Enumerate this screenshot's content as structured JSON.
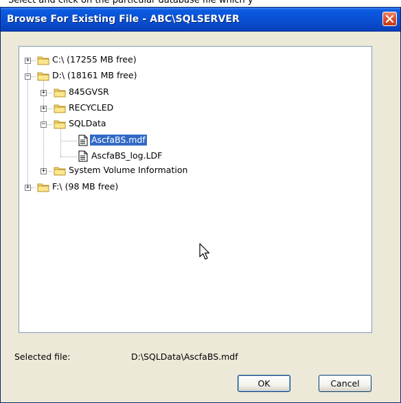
{
  "caption": "Select and click on the particular database file which y",
  "dialog": {
    "title": "Browse For Existing File - ABC\\SQLSERVER",
    "close_icon": "close-x"
  },
  "tree": {
    "nodes": [
      {
        "label": "C:\\ (17255 MB free)",
        "icon": "folder",
        "expander": "+"
      },
      {
        "label": "D:\\ (18161 MB free)",
        "icon": "folder",
        "expander": "-"
      },
      {
        "label": "845GVSR",
        "icon": "folder",
        "expander": "+"
      },
      {
        "label": "RECYCLED",
        "icon": "folder",
        "expander": "+"
      },
      {
        "label": "SQLData",
        "icon": "folder",
        "expander": "-"
      },
      {
        "label": "AscfaBS.mdf",
        "icon": "file",
        "selected": true
      },
      {
        "label": "AscfaBS_log.LDF",
        "icon": "file"
      },
      {
        "label": "System Volume Information",
        "icon": "folder",
        "expander": "+"
      },
      {
        "label": "F:\\ (98 MB free)",
        "icon": "folder",
        "expander": "+"
      }
    ]
  },
  "selected_file": {
    "label": "Selected file:",
    "value": "D:\\SQLData\\AscfaBS.mdf"
  },
  "buttons": {
    "ok": "OK",
    "cancel": "Cancel"
  },
  "colors": {
    "titlebar": "#0a4ed1",
    "selection": "#316ac5",
    "dialog_bg": "#ece9d8",
    "close_button": "#e0532f"
  }
}
